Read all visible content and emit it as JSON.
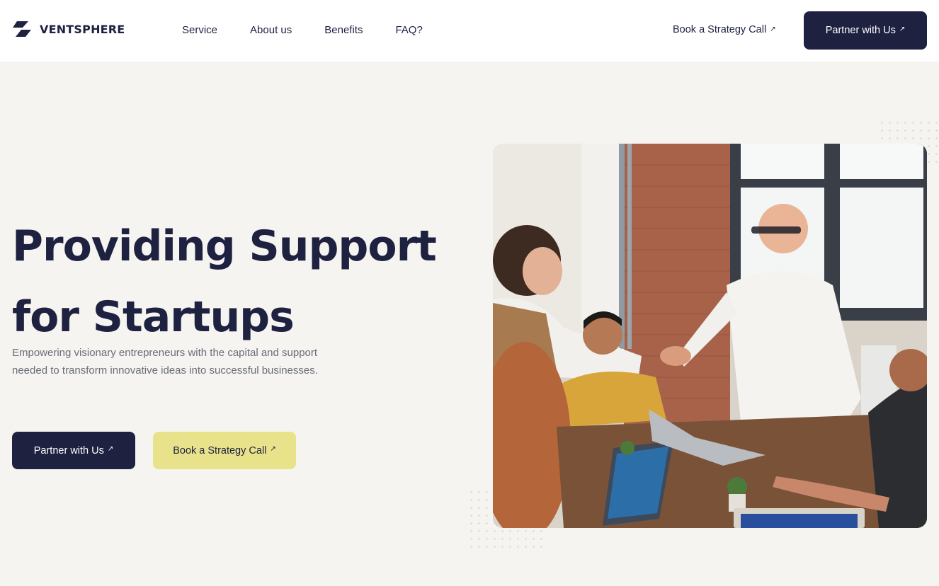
{
  "brand": {
    "name": "VENTSPHERE",
    "logo_icon": "ventsphere-logo-icon"
  },
  "nav": {
    "links": [
      "Service",
      "About us",
      "Benefits",
      "FAQ?"
    ],
    "cta_text": "Book a Strategy Call",
    "cta_button": "Partner with Us",
    "arrow": "↗"
  },
  "hero": {
    "title_line1": "Providing Support",
    "title_line2": "for Startups",
    "description": "Empowering visionary entrepreneurs with the capital and support needed to transform innovative ideas into successful businesses.",
    "primary_button": "Partner with Us",
    "secondary_button": "Book a Strategy Call",
    "arrow": "↗",
    "image_subject": "team-meeting-handshake-photo"
  },
  "colors": {
    "navy": "#1e2140",
    "yellow": "#e8e38a",
    "background": "#f5f4f0",
    "muted_text": "#6b6d7a"
  }
}
